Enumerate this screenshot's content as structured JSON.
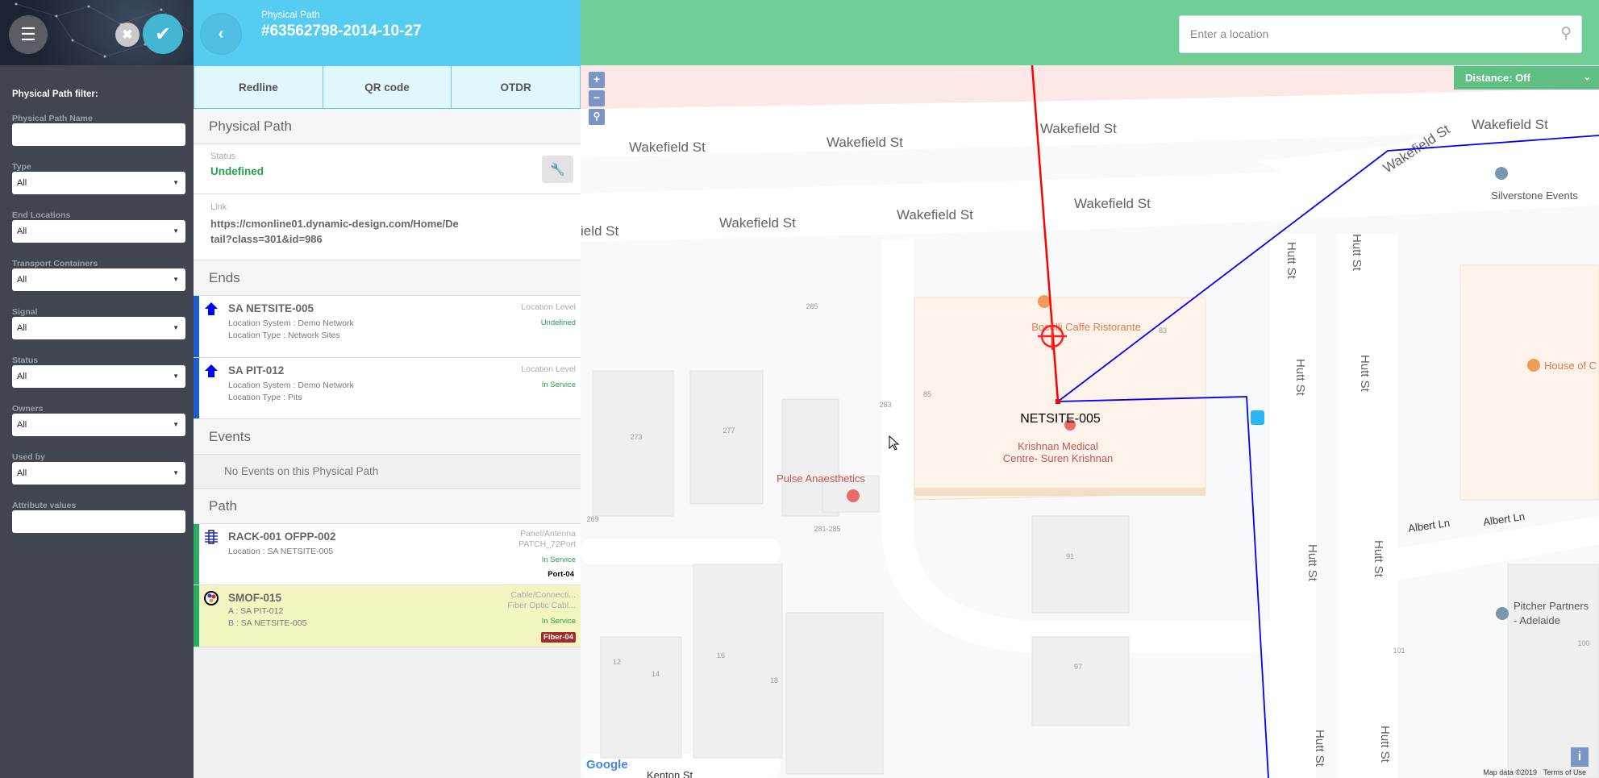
{
  "sidebar": {
    "menu_icon": "hamburger-icon",
    "cancel_icon": "x-icon",
    "confirm_icon": "check-icon",
    "filter_title": "Physical Path filter:",
    "fields": [
      {
        "label": "Physical Path Name",
        "value": ""
      },
      {
        "label": "Type",
        "value": "All"
      },
      {
        "label": "End Locations",
        "value": "All"
      },
      {
        "label": "Transport Containers",
        "value": "All"
      },
      {
        "label": "Signal",
        "value": "All"
      },
      {
        "label": "Status",
        "value": "All"
      },
      {
        "label": "Owners",
        "value": "All"
      },
      {
        "label": "Used by",
        "value": "All"
      },
      {
        "label": "Attribute values",
        "value": ""
      }
    ]
  },
  "detail": {
    "subtitle": "Physical Path",
    "title": "#63562798-2014-10-27",
    "tabs": [
      "Redline",
      "QR code",
      "OTDR"
    ],
    "section_path": "Physical Path",
    "status_label": "Status",
    "status_value": "Undefined",
    "link_label": "Link",
    "link_value": "https://cmonline01.dynamic-design.com/Home/Detail?class=301&id=986",
    "section_ends": "Ends",
    "ends": [
      {
        "name": "SA NETSITE-005",
        "system": "Location System : Demo Network",
        "type": "Location Type : Network Sites",
        "level": "Location Level",
        "status": "Undefined"
      },
      {
        "name": "SA PIT-012",
        "system": "Location System : Demo Network",
        "type": "Location Type : Pits",
        "level": "Location Level",
        "status": "In Service"
      }
    ],
    "section_events": "Events",
    "no_events": "No Events on this Physical Path",
    "section_route": "Path",
    "path": [
      {
        "name": "RACK-001 OFPP-002",
        "line1": "Location : SA NETSITE-005",
        "kind": "Panel/Antenna",
        "model": "PATCH_72Port",
        "status": "In Service",
        "badge": "Port-04"
      },
      {
        "name": "SMOF-015",
        "line1": "A : SA PIT-012",
        "line2": "B : SA NETSITE-005",
        "kind": "Cable/Connecti...",
        "model": "Fiber Optic Cabl...",
        "status": "In Service",
        "badge": "Fiber-04"
      }
    ],
    "colors": {
      "header": "#56cdf0",
      "ends_bar": "#1a5fd0",
      "path_bar": "#27ae60",
      "selected_row": "#f2f5c0",
      "badge": "#a52a2a"
    }
  },
  "map": {
    "search_placeholder": "Enter a location",
    "distance": "Distance: Off",
    "zoom_in": "+",
    "zoom_out": "−",
    "google": "Google",
    "map_data": "Map data ©2019",
    "terms": "Terms of Use",
    "info": "i",
    "site_label": "NETSITE-005",
    "streets": {
      "wakefield": "Wakefield St",
      "wakefield_partial": "ield St",
      "hutt": "Hutt St",
      "albert": "Albert Ln",
      "kenton": "Kenton St"
    },
    "pois": {
      "bocelli": "Bocelli Caffe Ristorante",
      "krishnan1": "Krishnan Medical",
      "krishnan2": "Centre- Suren Krishnan",
      "pulse": "Pulse Anaesthetics",
      "silverstone": "Silverstone Events",
      "house": "House of C",
      "pitcher1": "Pitcher Partners",
      "pitcher2": "- Adelaide"
    },
    "numbers": {
      "n285": "285",
      "n273": "273",
      "n277": "277",
      "n283": "283",
      "n85": "85",
      "n83": "83",
      "n269": "269",
      "n281": "281-285",
      "n91": "91",
      "n12": "12",
      "n14": "14",
      "n16": "16",
      "n18": "18",
      "n97": "97",
      "n101": "101",
      "n100": "100"
    },
    "colors": {
      "header": "#70cf97",
      "route_red": "#ff0000",
      "route_blue": "#0000ff"
    }
  }
}
